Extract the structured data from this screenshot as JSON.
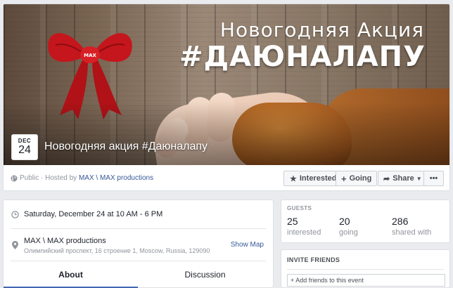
{
  "cover": {
    "subtitle": "Новогодняя Акция",
    "hashtag": "#ДАЮНАЛАПУ",
    "bow_logo": "MAX"
  },
  "event": {
    "month": "DEC",
    "day": "24",
    "title": "Новогодняя акция #Даюналапу"
  },
  "meta": {
    "privacy": "Public",
    "hosted_prefix": " · Hosted by ",
    "host": "MAX \\ MAX productions"
  },
  "actions": {
    "interested": "Interested",
    "going": "Going",
    "share": "Share",
    "more": "•••"
  },
  "details": {
    "datetime": "Saturday, December 24 at 10 AM - 6 PM",
    "venue": "MAX \\ MAX productions",
    "address": "Олимпийский проспект, 16 строение 1, Moscow, Russia, 129090",
    "show_map": "Show Map"
  },
  "tabs": {
    "about": "About",
    "discussion": "Discussion"
  },
  "guests": {
    "heading": "GUESTS",
    "stats": [
      {
        "value": "25",
        "label": "interested"
      },
      {
        "value": "20",
        "label": "going"
      },
      {
        "value": "286",
        "label": "shared with"
      }
    ]
  },
  "invite": {
    "heading": "INVITE FRIENDS",
    "placeholder": "+ Add friends to this event"
  },
  "colors": {
    "link": "#365899",
    "tab_accent": "#4267b2",
    "bow": "#c4161c",
    "page_bg": "#e9ebee"
  },
  "icons": [
    "globe-icon",
    "star-icon",
    "plus-icon",
    "share-icon",
    "caret-down-icon",
    "clock-icon",
    "location-pin-icon"
  ]
}
